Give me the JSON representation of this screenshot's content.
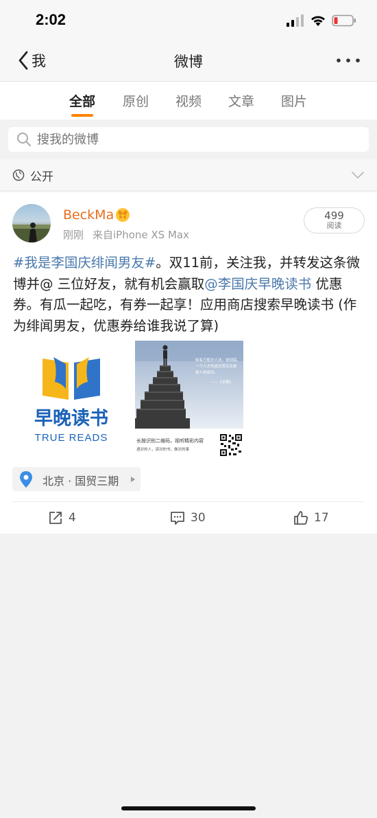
{
  "status_bar": {
    "time": "2:02"
  },
  "nav": {
    "back_label": "我",
    "title": "微博"
  },
  "tabs": [
    {
      "label": "全部"
    },
    {
      "label": "原创"
    },
    {
      "label": "视频"
    },
    {
      "label": "文章"
    },
    {
      "label": "图片"
    }
  ],
  "search": {
    "placeholder": "搜我的微博"
  },
  "filter": {
    "label": "公开"
  },
  "post": {
    "username": "BeckMa",
    "time": "刚刚",
    "source": "来自iPhone XS Max",
    "read_count": "499",
    "read_label": "阅读",
    "topic_link": "#我是李国庆绯闻男友#",
    "text_1": "。双11前，关注我，并转发这条微博并@ 三位好友，就有机会赢取",
    "mention_link": "@李国庆早晚读书",
    "text_2": " 优惠券。有瓜一起吃，有券一起享！应用商店搜索早晚读书 (作为绯闻男友，优惠券给谁我说了算)",
    "image_1": {
      "brand_cn": "早晚读书",
      "brand_en": "TRUE READS"
    },
    "image_2": {
      "quote_lines": [
        "纵有万般识人法，说到底，",
        "一个人才的成功其实还是",
        "他人的成功。"
      ],
      "quote_source": "——《水镜》",
      "caption_1": "长按识别二维码，视听精彩内容",
      "caption_2": "遇对的人，读对的书，做对的事"
    },
    "location": "北京 · 国贸三期",
    "reposts": "4",
    "comments": "30",
    "likes": "17"
  },
  "colors": {
    "accent": "#ff8200",
    "link": "#4a78ab",
    "username": "#e86d1d"
  }
}
